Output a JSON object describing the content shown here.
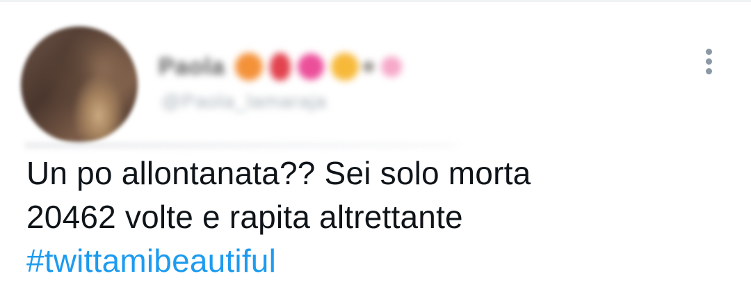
{
  "tweet": {
    "author": {
      "display_name": "Paola",
      "handle": "@Paola_lamaraja",
      "emojis": [
        {
          "name": "orange-circle",
          "color": "#f4923a"
        },
        {
          "name": "red-balloon",
          "color": "#e2434f"
        },
        {
          "name": "pink-flower",
          "color": "#ec4f9a"
        },
        {
          "name": "yellow-flower",
          "color": "#f7b93a"
        },
        {
          "name": "small-flower",
          "color": "#c9c4bf"
        },
        {
          "name": "light-pink-flower",
          "color": "#f6a9c9"
        }
      ]
    },
    "text_lines": [
      "Un po allontanata?? Sei solo morta",
      "20462 volte e rapita altrettante"
    ],
    "hashtag": "#twittamibeautiful",
    "more_icon": "more-vertical-icon"
  },
  "colors": {
    "text": "#0f1419",
    "link": "#1d9bf0",
    "icon": "#8b98a5",
    "divider": "#eff3f4"
  }
}
